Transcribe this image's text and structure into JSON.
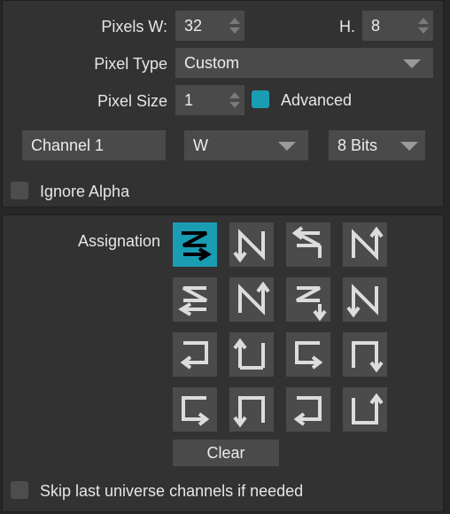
{
  "pixels": {
    "w_label": "Pixels W:",
    "w_value": "32",
    "h_label": "H.",
    "h_value": "8"
  },
  "pixel_type": {
    "label": "Pixel Type",
    "value": "Custom"
  },
  "pixel_size": {
    "label": "Pixel Size",
    "value": "1",
    "advanced_label": "Advanced",
    "advanced_checked": true
  },
  "channel": {
    "name": "Channel 1",
    "color": "W",
    "bits": "8 Bits"
  },
  "ignore_alpha": {
    "label": "Ignore Alpha",
    "checked": false
  },
  "assignation": {
    "label": "Assignation",
    "selected_index": 0,
    "patterns": [
      "z-right-down",
      "n-down-right",
      "z-left-down",
      "n-up-right",
      "s-left-down",
      "n-up-left",
      "s-right-down",
      "n-down-left",
      "snake-left",
      "snake-up",
      "snake-right",
      "snake-down",
      "snake-right-bottom",
      "snake-down-left",
      "snake-left-bottom",
      "snake-up-right"
    ]
  },
  "clear_button": "Clear",
  "skip_channels": {
    "label": "Skip last universe channels if needed",
    "checked": false
  },
  "colors": {
    "accent": "#1a9cb3",
    "panel": "#323232",
    "field": "#4a4a4a"
  }
}
